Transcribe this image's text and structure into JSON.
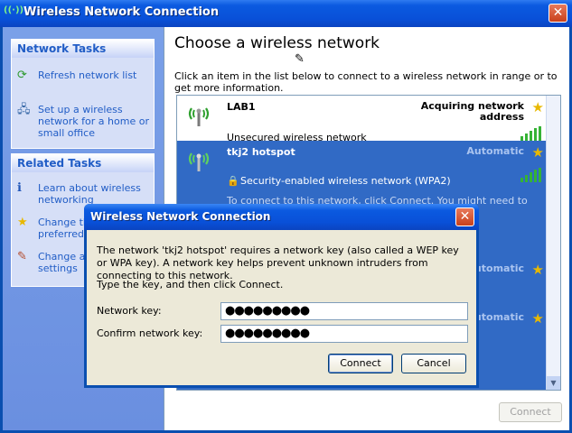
{
  "window": {
    "title": "Wireless Network Connection",
    "close_glyph": "✕"
  },
  "left": {
    "network_tasks": {
      "heading": "Network Tasks",
      "items": [
        {
          "label": "Refresh network list",
          "icon": "refresh-icon"
        },
        {
          "label": "Set up a wireless network for a home or small office",
          "icon": "setup-wireless-icon"
        }
      ]
    },
    "related_tasks": {
      "heading": "Related Tasks",
      "items": [
        {
          "label": "Learn about wireless networking",
          "icon": "info-icon"
        },
        {
          "label": "Change the order of preferred networks",
          "icon": "star-icon"
        },
        {
          "label": "Change advanced settings",
          "icon": "advanced-settings-icon"
        }
      ]
    }
  },
  "main": {
    "title": "Choose a wireless network",
    "instruction": "Click an item in the list below to connect to a wireless network in range or to get more information.",
    "networks": [
      {
        "name": "LAB1",
        "status": "Acquiring network address",
        "security": "Unsecured wireless network",
        "signal": 4
      },
      {
        "name": "tkj2 hotspot",
        "status": "Automatic",
        "security": "Security-enabled wireless network (WPA2)",
        "detail": "To connect to this network, click Connect. You might need to enter",
        "signal": 4
      }
    ],
    "hidden_status_1": "Automatic",
    "hidden_status_2": "Automatic",
    "connect_label": "Connect"
  },
  "dialog": {
    "title": "Wireless Network Connection",
    "message": "The network 'tkj2 hotspot' requires a network key (also called a WEP key or WPA key). A network key helps prevent unknown intruders from connecting to this network.",
    "prompt": "Type the key, and then click Connect.",
    "key_label": "Network key:",
    "key_value": "●●●●●●●●●",
    "confirm_label": "Confirm network key:",
    "confirm_value": "●●●●●●●●●",
    "connect_label": "Connect",
    "cancel_label": "Cancel"
  },
  "colors": {
    "selected_row": "#316ac5",
    "title_blue": "#0950d8",
    "task_link": "#215dc6"
  }
}
